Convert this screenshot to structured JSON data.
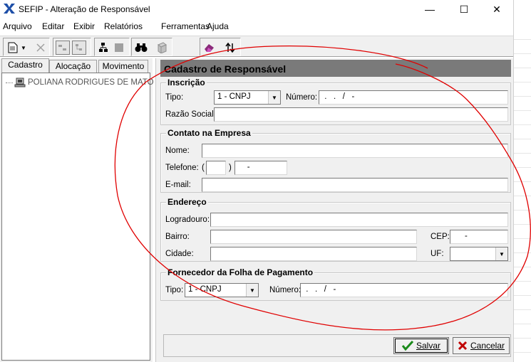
{
  "window": {
    "title": "SEFIP - Alteração de Responsável",
    "controls": {
      "minimize": "—",
      "maximize": "☐",
      "close": "✕"
    }
  },
  "menu": [
    "Arquivo",
    "Editar",
    "Exibir",
    "Relatórios",
    "Ferramentas",
    "Ajuda"
  ],
  "tabs": [
    "Cadastro",
    "Alocação",
    "Movimento"
  ],
  "tree": {
    "item": "POLIANA RODRIGUES DE MATO"
  },
  "form": {
    "header": "Cadastro de Responsável",
    "inscricao": {
      "title": "Inscrição",
      "tipo_label": "Tipo:",
      "tipo_value": "1 - CNPJ",
      "numero_label": "Número:",
      "numero_value": " .   .   /   -",
      "razao_label": "Razão Social:",
      "razao_value": ""
    },
    "contato": {
      "title": "Contato na Empresa",
      "nome_label": "Nome:",
      "nome_value": "",
      "telefone_label": "Telefone:",
      "paren_open": "(",
      "paren_close": ")",
      "ddd_value": "",
      "telefone_value": "    -",
      "email_label": "E-mail:",
      "email_value": ""
    },
    "endereco": {
      "title": "Endereço",
      "logradouro_label": "Logradouro:",
      "logradouro_value": "",
      "bairro_label": "Bairro:",
      "bairro_value": "",
      "cep_label": "CEP:",
      "cep_value": "     -",
      "cidade_label": "Cidade:",
      "cidade_value": "",
      "uf_label": "UF:",
      "uf_value": ""
    },
    "fornecedor": {
      "title": "Fornecedor da Folha de Pagamento",
      "tipo_label": "Tipo:",
      "tipo_value": "1 - CNPJ",
      "numero_label": "Número:",
      "numero_value": " .   .   /   -"
    }
  },
  "buttons": {
    "salvar": "Salvar",
    "cancelar": "Cancelar"
  },
  "colors": {
    "header_bar": "#7a7a7a",
    "annotation_red": "#e00000",
    "save_check": "#1a8a1a",
    "cancel_x": "#c00000"
  }
}
